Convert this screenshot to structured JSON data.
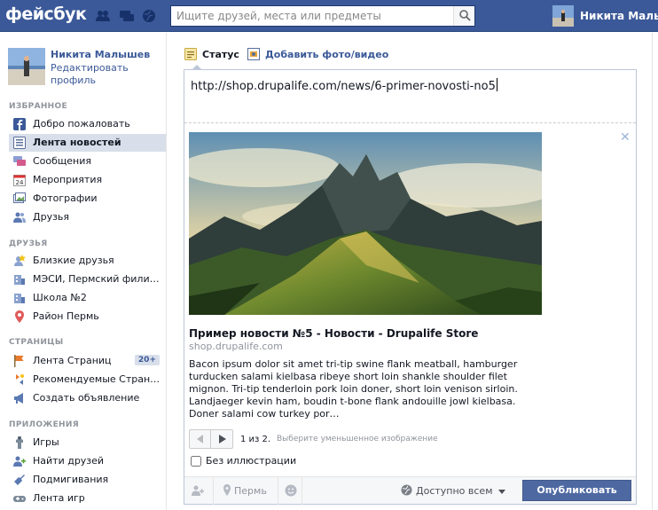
{
  "header": {
    "logo": "фейсбук",
    "search_placeholder": "Ищите друзей, места или предметы",
    "user_name": "Никита Малыш"
  },
  "profile": {
    "name": "Никита Малышев",
    "edit_label": "Редактировать профиль"
  },
  "sidebar": {
    "favorites_title": "ИЗБРАННОЕ",
    "favorites": [
      {
        "label": "Добро пожаловать",
        "icon": "facebook-icon"
      },
      {
        "label": "Лента новостей",
        "icon": "news-feed-icon"
      },
      {
        "label": "Сообщения",
        "icon": "messages-icon"
      },
      {
        "label": "Мероприятия",
        "icon": "calendar-icon"
      },
      {
        "label": "Фотографии",
        "icon": "photos-icon"
      },
      {
        "label": "Друзья",
        "icon": "friends-icon"
      }
    ],
    "friends_title": "ДРУЗЬЯ",
    "friends": [
      {
        "label": "Близкие друзья",
        "icon": "star-icon"
      },
      {
        "label": "МЭСИ, Пермский фили…",
        "icon": "building-icon"
      },
      {
        "label": "Школа №2",
        "icon": "building-icon"
      },
      {
        "label": "Район Пермь",
        "icon": "location-pin-icon"
      }
    ],
    "pages_title": "СТРАНИЦЫ",
    "pages": [
      {
        "label": "Лента Страниц",
        "icon": "flag-icon",
        "badge": "20+"
      },
      {
        "label": "Рекомендуемые Стран…",
        "icon": "recommended-icon"
      },
      {
        "label": "Создать объявление",
        "icon": "megaphone-icon"
      }
    ],
    "apps_title": "ПРИЛОЖЕНИЯ",
    "apps": [
      {
        "label": "Игры",
        "icon": "games-icon"
      },
      {
        "label": "Найти друзей",
        "icon": "find-friends-icon"
      },
      {
        "label": "Подмигивания",
        "icon": "poke-icon"
      },
      {
        "label": "Лента игр",
        "icon": "games-feed-icon"
      }
    ]
  },
  "composer": {
    "tab_status": "Статус",
    "tab_photo": "Добавить фото/видео",
    "url": "http://shop.drupalife.com/news/6-primer-novosti-no5",
    "link_title": "Пример новости №5 - Новости - Drupalife Store",
    "link_domain": "shop.drupalife.com",
    "link_description": "Bacon ipsum dolor sit amet tri-tip swine flank meatball, hamburger turducken salami kielbasa ribeye short loin shankle shoulder filet mignon. Tri-tip tenderloin pork loin doner, short loin venison sirloin. Landjaeger kevin ham, boudin t-bone flank andouille jowl kielbasa. Doner salami cow turkey por…",
    "pager_count": "1 из 2.",
    "pager_hint": "Выберите уменьшенное изображение",
    "no_image_label": "Без иллюстрации",
    "location_label": "Пермь",
    "audience_label": "Доступно всем",
    "publish_label": "Опубликовать"
  },
  "colors": {
    "brand": "#3b5998",
    "publish": "#4e69a2"
  }
}
